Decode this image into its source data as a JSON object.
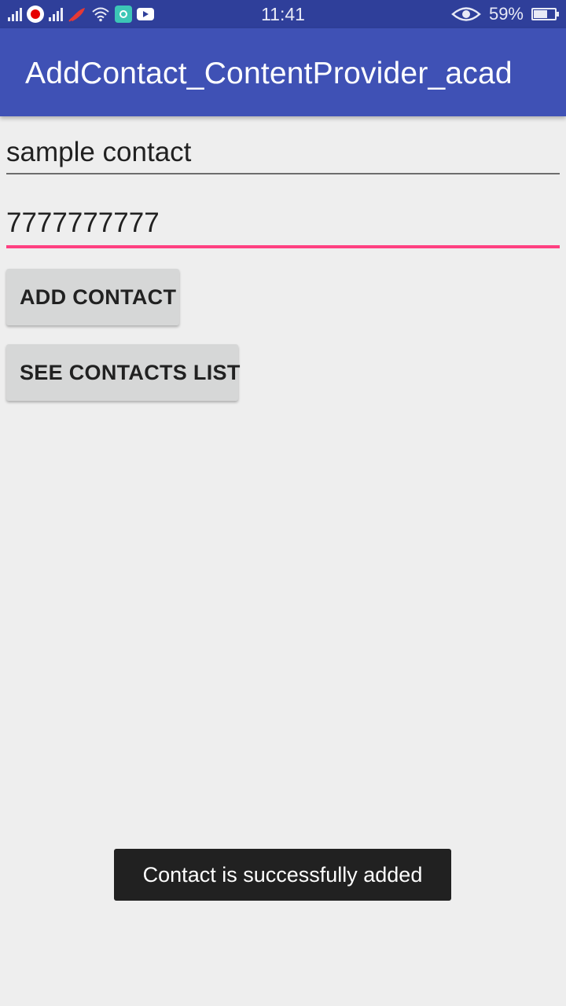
{
  "status_bar": {
    "time": "11:41",
    "battery_percent": "59%",
    "battery_level": 0.59,
    "icons": [
      "signal-icon",
      "vodafone-icon",
      "signal-icon",
      "rocket-icon",
      "wifi-icon",
      "app-notification-icon",
      "youtube-icon",
      "eye-icon",
      "battery-icon"
    ]
  },
  "app_bar": {
    "title": "AddContact_ContentProvider_acad"
  },
  "form": {
    "name_value": "sample contact",
    "phone_value": "7777777777"
  },
  "buttons": {
    "add_contact": "ADD CONTACT",
    "see_contacts_list": "SEE CONTACTS LIST"
  },
  "toast": {
    "message": "Contact is successfully added"
  },
  "colors": {
    "status_bar": "#2f3f9a",
    "app_bar": "#3f51b5",
    "accent": "#ff4081",
    "background": "#eeeeee",
    "button": "#d6d7d7",
    "toast": "#212121"
  }
}
